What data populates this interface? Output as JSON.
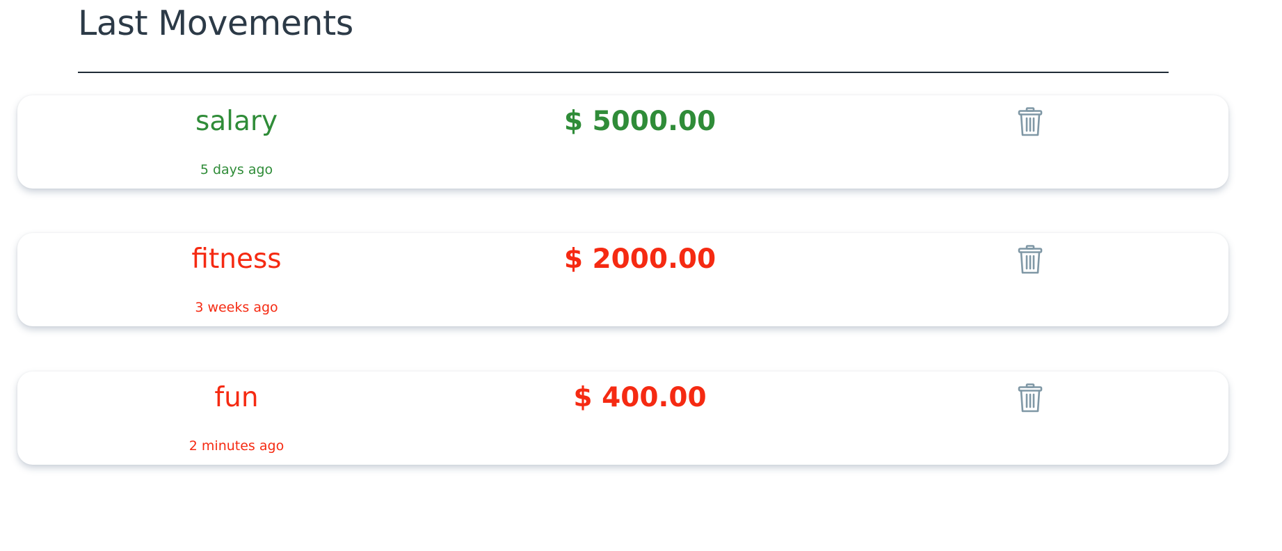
{
  "header": {
    "title": "Last Movements"
  },
  "colors": {
    "income": "#2f8c38",
    "expense": "#f52a12",
    "trash_icon": "#7f97a5",
    "title": "#2c3a47"
  },
  "movements": [
    {
      "category": "salary",
      "time": "5 days ago",
      "amount": "$ 5000.00",
      "type": "income",
      "action_icon": "trash-icon"
    },
    {
      "category": "fitness",
      "time": "3 weeks ago",
      "amount": "$ 2000.00",
      "type": "expense",
      "action_icon": "trash-icon"
    },
    {
      "category": "fun",
      "time": "2 minutes ago",
      "amount": "$ 400.00",
      "type": "expense",
      "action_icon": "trash-icon"
    }
  ]
}
